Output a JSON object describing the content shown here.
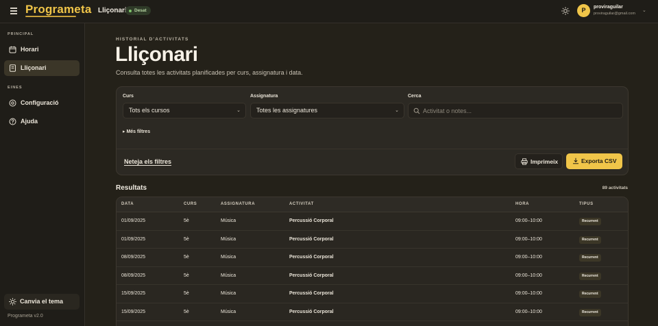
{
  "app": {
    "logo": "Programeta",
    "page_name": "Lliçonari",
    "env_badge": "Desat"
  },
  "user": {
    "initial": "P",
    "name": "proviraguilar",
    "email": "proviraguilar@gmail.com"
  },
  "sidebar": {
    "section_principal": "PRINCIPAL",
    "section_eines": "EINES",
    "items": [
      {
        "label": "Horari",
        "icon": "calendar-icon",
        "active": false
      },
      {
        "label": "Lliçonari",
        "icon": "notebook-icon",
        "active": true
      },
      {
        "label": "Configuració",
        "icon": "settings-icon",
        "active": false
      },
      {
        "label": "Ajuda",
        "icon": "help-icon",
        "active": false
      }
    ],
    "theme_button": "Canvia el tema",
    "version": "Programeta v2.0"
  },
  "header": {
    "eyebrow": "HISTORIAL D'ACTIVITATS",
    "title": "Lliçonari",
    "subtitle": "Consulta totes les activitats planificades per curs, assignatura i data."
  },
  "filters": {
    "course_label": "Curs",
    "course_value": "Tots els cursos",
    "subject_label": "Assignatura",
    "subject_value": "Totes les assignatures",
    "search_label": "Cerca",
    "search_placeholder": "Activitat o notes...",
    "more_filters": "▸ Més filtres",
    "clear": "Neteja els filtres",
    "print": "Imprimeix",
    "export_csv": "Exporta CSV"
  },
  "results": {
    "title": "Resultats",
    "count": "89 activitats",
    "columns": [
      "DATA",
      "CURS",
      "ASSIGNATURA",
      "ACTIVITAT",
      "HORA",
      "TIPUS"
    ],
    "rows": [
      {
        "date": "01/09/2025",
        "course": "5è",
        "subject": "Música",
        "activity": "Percussió Corporal",
        "time": "09:00–10:00",
        "type": "Recurrent"
      },
      {
        "date": "01/09/2025",
        "course": "5è",
        "subject": "Música",
        "activity": "Percussió Corporal",
        "time": "09:00–10:00",
        "type": "Recurrent"
      },
      {
        "date": "08/09/2025",
        "course": "5è",
        "subject": "Música",
        "activity": "Percussió Corporal",
        "time": "09:00–10:00",
        "type": "Recurrent"
      },
      {
        "date": "08/09/2025",
        "course": "5è",
        "subject": "Música",
        "activity": "Percussió Corporal",
        "time": "09:00–10:00",
        "type": "Recurrent"
      },
      {
        "date": "15/09/2025",
        "course": "5è",
        "subject": "Música",
        "activity": "Percussió Corporal",
        "time": "09:00–10:00",
        "type": "Recurrent"
      },
      {
        "date": "15/09/2025",
        "course": "5è",
        "subject": "Música",
        "activity": "Percussió Corporal",
        "time": "09:00–10:00",
        "type": "Recurrent"
      }
    ]
  },
  "colors": {
    "accent": "#f0c549",
    "background": "#242119",
    "sidebar": "#1f1d18"
  }
}
